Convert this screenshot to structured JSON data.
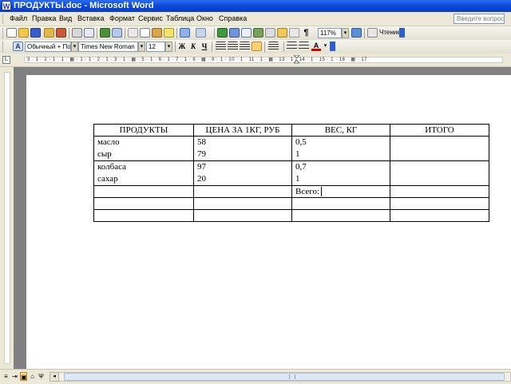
{
  "window": {
    "title": "ПРОДУКТЫ.doc - Microsoft Word"
  },
  "menu": {
    "items": [
      "Файл",
      "Правка",
      "Вид",
      "Вставка",
      "Формат",
      "Сервис",
      "Таблица",
      "Окно",
      "Справка"
    ],
    "help_placeholder": "Введите вопрос"
  },
  "toolbar_standard": {
    "zoom": "117%",
    "reading_label": "Чтение"
  },
  "toolbar_formatting": {
    "style": "Обычный + Пол",
    "font": "Times New Roman",
    "size": "12",
    "bold": "Ж",
    "italic": "К",
    "underline": "Ч",
    "font_color_glyph": "A"
  },
  "ruler": {
    "numbers": "3 · 1 · 2 · 1 · 1 · ▦ · 1 · 1 · 2 · 1 · 3 · 1 · ▦ · 5 · 1 · 6 · 1 · 7 · 1 · 8 · ▦ · 9 · 1 · 10 · 1 · 11 · 1 · ▦ · 13 · 1 · 14 · 1 · 15 · 1 · 16 · ▦ · 17"
  },
  "table": {
    "headers": [
      "ПРОДУКТЫ",
      "ЦЕНА ЗА 1КГ, РУБ",
      "ВЕС, КГ",
      "ИТОГО"
    ],
    "rows": [
      {
        "products": [
          "масло",
          "сыр"
        ],
        "prices": [
          "58",
          "79"
        ],
        "weights": [
          "0,5",
          "1"
        ],
        "total": ""
      },
      {
        "products": [
          "колбаса",
          "сахар"
        ],
        "prices": [
          "97",
          "20"
        ],
        "weights": [
          "0,7",
          "1"
        ],
        "total": ""
      }
    ],
    "total_label": "Всего:"
  },
  "statusbar": {
    "view_buttons": [
      "≡",
      "⇥",
      "▣",
      "⌂",
      "Ψ"
    ],
    "scroll_left": "◂"
  }
}
